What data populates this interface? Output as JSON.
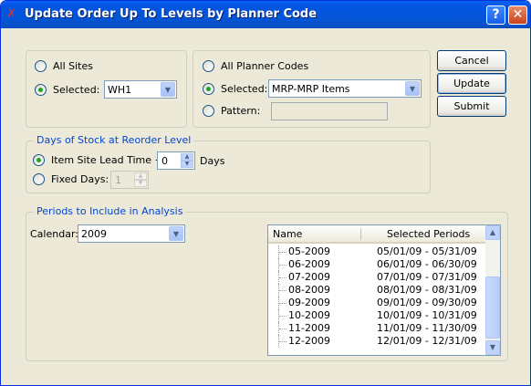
{
  "window": {
    "title": "Update Order Up To Levels by Planner Code",
    "help_label": "?",
    "close_label": "✕"
  },
  "sites": {
    "all_label": "All Sites",
    "selected_label": "Selected:",
    "selected_value": "WH1",
    "mode": "selected"
  },
  "planner": {
    "all_label": "All Planner Codes",
    "selected_label": "Selected:",
    "selected_value": "MRP-MRP Items",
    "pattern_label": "Pattern:",
    "pattern_value": "",
    "mode": "selected"
  },
  "buttons": {
    "cancel": "Cancel",
    "update": "Update",
    "submit": "Submit"
  },
  "days": {
    "legend": "Days of Stock at Reorder Level",
    "lead_time_label": "Item Site Lead Time +",
    "lead_time_value": "0",
    "days_label": "Days",
    "fixed_label": "Fixed Days:",
    "fixed_value": "1",
    "mode": "lead_time"
  },
  "periods": {
    "legend": "Periods to Include in Analysis",
    "calendar_label": "Calendar:",
    "calendar_value": "2009",
    "columns": [
      "Name",
      "Selected Periods"
    ],
    "rows": [
      {
        "name": "05-2009",
        "range": "05/01/09 - 05/31/09"
      },
      {
        "name": "06-2009",
        "range": "06/01/09 - 06/30/09"
      },
      {
        "name": "07-2009",
        "range": "07/01/09 - 07/31/09"
      },
      {
        "name": "08-2009",
        "range": "08/01/09 - 08/31/09"
      },
      {
        "name": "09-2009",
        "range": "09/01/09 - 09/30/09"
      },
      {
        "name": "10-2009",
        "range": "10/01/09 - 10/31/09"
      },
      {
        "name": "11-2009",
        "range": "11/01/09 - 11/30/09"
      },
      {
        "name": "12-2009",
        "range": "12/01/09 - 12/31/09"
      }
    ]
  }
}
